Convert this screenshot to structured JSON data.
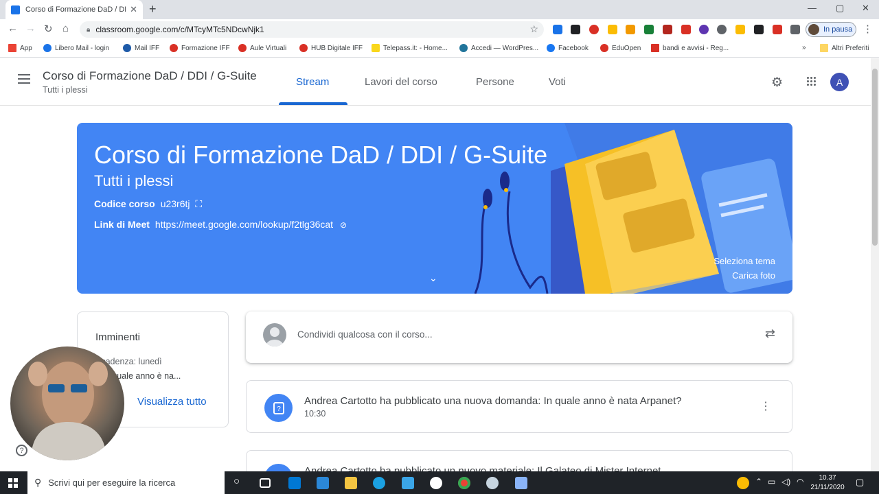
{
  "browser": {
    "tab_title": "Corso di Formazione DaD / DDI / ...",
    "url": "classroom.google.com/c/MTcyMTc5NDcwNjk1",
    "profile_status": "In pausa",
    "bookmarks": [
      {
        "label": "App",
        "icon": "apps-grid-icon",
        "color": "#ea4335"
      },
      {
        "label": "Libero Mail - login",
        "icon": "libero-icon",
        "color": "#1a73e8"
      },
      {
        "label": "Mail IFF",
        "icon": "mail-icon",
        "color": "#1e5aa8"
      },
      {
        "label": "Formazione IFF",
        "icon": "iff-icon",
        "color": "#d93025"
      },
      {
        "label": "Aule Virtuali",
        "icon": "iff-icon",
        "color": "#d93025"
      },
      {
        "label": "HUB Digitale IFF",
        "icon": "hub-icon",
        "color": "#d93025"
      },
      {
        "label": "Telepass.it: - Home...",
        "icon": "telepass-icon",
        "color": "#f9d71c"
      },
      {
        "label": "Accedi — WordPres...",
        "icon": "wordpress-icon",
        "color": "#21759b"
      },
      {
        "label": "Facebook",
        "icon": "facebook-icon",
        "color": "#1877f2"
      },
      {
        "label": "EduOpen",
        "icon": "eduopen-icon",
        "color": "#d93025"
      },
      {
        "label": "bandi e avvisi - Reg...",
        "icon": "flag-icon",
        "color": "#d93025"
      }
    ],
    "more_bookmarks": "»",
    "other_bookmarks": "Altri Preferiti"
  },
  "header": {
    "course_title": "Corso di Formazione DaD / DDI / G-Suite",
    "course_subtitle": "Tutti i plessi",
    "tabs": [
      {
        "label": "Stream",
        "active": true
      },
      {
        "label": "Lavori del corso",
        "active": false
      },
      {
        "label": "Persone",
        "active": false
      },
      {
        "label": "Voti",
        "active": false
      }
    ],
    "avatar_initial": "A"
  },
  "banner": {
    "title": "Corso di Formazione DaD / DDI / G-Suite",
    "subtitle": "Tutti i plessi",
    "code_label": "Codice corso",
    "code_value": "u23r6tj",
    "meet_label": "Link di Meet",
    "meet_url": "https://meet.google.com/lookup/f2tlg36cat",
    "select_theme": "Seleziona tema",
    "upload_photo": "Carica foto",
    "color": "#4285f4"
  },
  "upcoming": {
    "title": "Imminenti",
    "due": "Scadenza: lunedì",
    "item": "– In quale anno è na...",
    "view_all": "Visualizza tutto"
  },
  "share": {
    "placeholder": "Condividi qualcosa con il corso..."
  },
  "posts": [
    {
      "title": "Andrea Cartotto ha pubblicato una nuova domanda: In quale anno è nata Arpanet?",
      "time": "10:30",
      "icon": "question-icon"
    },
    {
      "title": "Andrea Cartotto ha pubblicato un nuovo materiale: Il Galateo di Mister Internet",
      "time": "",
      "icon": "material-icon"
    }
  ],
  "taskbar": {
    "search_placeholder": "Scrivi qui per eseguire la ricerca",
    "time": "10.37",
    "date": "21/11/2020"
  }
}
